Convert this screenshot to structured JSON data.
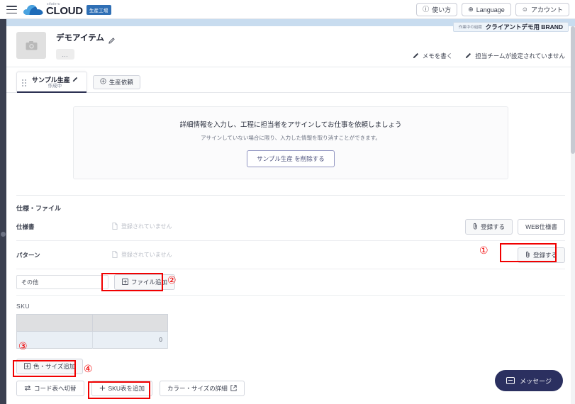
{
  "topbar": {
    "menu_icon": "hamburger-icon",
    "logo_small": "sitateru",
    "logo_main": "CLOUD",
    "logo_badge": "生産工場",
    "buttons": [
      {
        "icon": "question-circle-icon",
        "glyph": "ⓘ",
        "label": "使い方"
      },
      {
        "icon": "globe-icon",
        "glyph": "⊕",
        "label": "Language"
      },
      {
        "icon": "account-circle-icon",
        "glyph": "☺",
        "label": "アカウント"
      }
    ]
  },
  "org_badge": {
    "prefix": "作業中の組織",
    "name": "クライアントデモ用 BRAND"
  },
  "item_header": {
    "thumbnail_icon": "camera-placeholder-icon",
    "title": "デモアイテム",
    "edit_icon": "pencil-icon",
    "more_label": "…",
    "links": [
      {
        "icon": "pencil-icon",
        "label": "メモを書く"
      },
      {
        "icon": "pencil-icon",
        "label": "担当チームが設定されていません"
      }
    ]
  },
  "tabs": {
    "active": {
      "grip_icon": "drag-grip-icon",
      "title": "サンプル生産",
      "edit_icon": "pencil-icon",
      "status": "作成中"
    },
    "add_button": {
      "icon": "plus-circle-icon",
      "label": "生産依頼"
    }
  },
  "notice": {
    "line1": "詳細情報を入力し、工程に担当者をアサインしてお仕事を依頼しましょう",
    "line2": "アサインしていない場合に限り、入力した情報を取り消すことができます。",
    "delete_button": "サンプル生産 を削除する"
  },
  "spec_section": {
    "title": "仕様・ファイル",
    "rows": [
      {
        "label": "仕様書",
        "empty_text": "登録されていません",
        "empty_icon": "file-icon",
        "buttons": [
          {
            "icon": "paperclip-icon",
            "label": "登録する"
          },
          {
            "icon": "none",
            "label": "WEB仕様書"
          }
        ]
      },
      {
        "label": "パターン",
        "empty_text": "登録されていません",
        "empty_icon": "file-icon",
        "buttons": [
          {
            "icon": "paperclip-icon",
            "label": "登録する"
          }
        ]
      }
    ],
    "other_row": {
      "input_value": "その他",
      "input_placeholder": "その他",
      "file_add_button": {
        "icon": "file-add-icon",
        "label": "ファイル追加"
      }
    }
  },
  "sku_section": {
    "label": "SKU",
    "table": {
      "headers": [
        "",
        ""
      ],
      "rows": [
        [
          "",
          "0"
        ]
      ]
    },
    "buttons_row1": [
      {
        "icon": "grid-add-icon",
        "label": "色・サイズ追加"
      }
    ],
    "buttons_row2": [
      {
        "icon": "swap-icon",
        "label": "コード表へ切替"
      },
      {
        "icon": "plus-icon",
        "label": "SKU表を追加"
      },
      {
        "icon": "external-link-icon",
        "label": "カラー・サイズの詳細"
      }
    ]
  },
  "annotations": [
    {
      "number": "①",
      "target": "register-pattern-button"
    },
    {
      "number": "②",
      "target": "file-add-button"
    },
    {
      "number": "③",
      "target": "sku-table"
    },
    {
      "number": "④",
      "target": "add-sku-table-button"
    }
  ],
  "message_widget": {
    "icon": "chat-icon",
    "label": "メッセージ"
  },
  "colors": {
    "accent_navy": "#2b3060",
    "band_blue": "#c8dcef",
    "annotation_red": "#f10000",
    "rail_dark": "#3b4050"
  }
}
